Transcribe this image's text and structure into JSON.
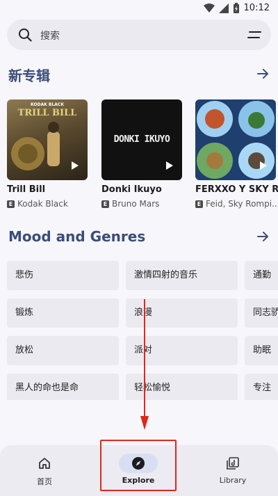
{
  "status_bar": {
    "time": "10:12"
  },
  "search": {
    "placeholder": "搜索"
  },
  "new_albums": {
    "title": "新专辑",
    "items": [
      {
        "title": "Trill Bill",
        "artist": "Kodak Black",
        "explicit_mark": "E",
        "cover_text": "TRILL BILL",
        "cover_small": "KODAK BLACK"
      },
      {
        "title": "Donki Ikuyo",
        "artist": "Bruno Mars",
        "explicit_mark": "E",
        "cover_text": "DONKI IKUYO"
      },
      {
        "title": "FERXXO Y SKY R",
        "artist": "Feid, Sky Rompi...",
        "explicit_mark": "E"
      }
    ]
  },
  "moods": {
    "title": "Mood and Genres",
    "items": [
      "悲伤",
      "激情四射的音乐",
      "通勤",
      "锻炼",
      "浪漫",
      "同志骄",
      "放松",
      "派对",
      "助眠",
      "黑人的命也是命",
      "轻松愉悦",
      "专注"
    ]
  },
  "nav": {
    "items": [
      {
        "label": "首页",
        "icon": "home-icon"
      },
      {
        "label": "Explore",
        "icon": "compass-icon",
        "active": true
      },
      {
        "label": "Library",
        "icon": "library-icon"
      }
    ]
  },
  "colors": {
    "accent": "#3a4d7a",
    "highlight": "#e0261b",
    "active_pill": "#d9dff3"
  }
}
